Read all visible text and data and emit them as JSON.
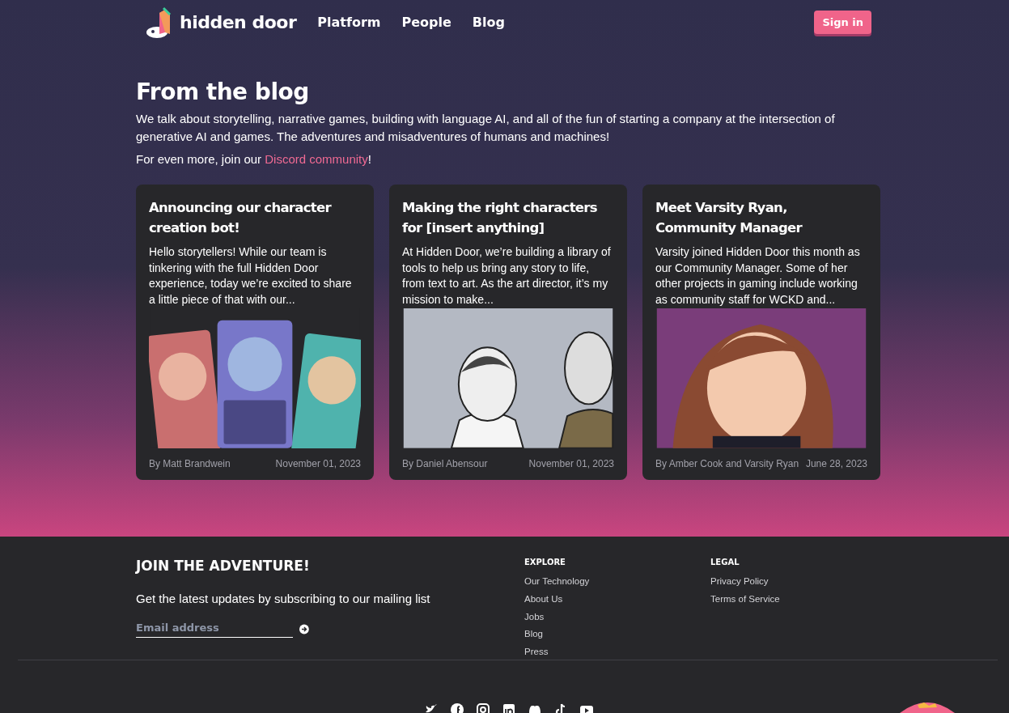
{
  "header": {
    "logo_text": "hidden door",
    "nav": [
      {
        "label": "Platform"
      },
      {
        "label": "People"
      },
      {
        "label": "Blog"
      }
    ],
    "sign_in": "Sign in"
  },
  "intro": {
    "title": "From the blog",
    "description": "We talk about storytelling, narrative games, building with language AI, and all of the fun of starting a company at the intersection of generative AI and games. The adventures and misadventures of humans and machines!",
    "more_prefix": "For even more, join our ",
    "more_link": "Discord community",
    "more_suffix": "!"
  },
  "posts": [
    {
      "title": "Announcing our character creation bot!",
      "excerpt": "Hello storytellers! While our team is tinkering with the full Hidden Door experience, today we’re excited to share a little piece of that with our...",
      "kind": "character-cards",
      "author": "By Matt Brandwein",
      "date": "November 01, 2023"
    },
    {
      "title": "Making the right characters for [insert anything]",
      "excerpt": "At Hidden Door, we’re building a library of tools to help us bring any story to life, from text to art. As the art director, it’s my mission to make...",
      "kind": "two-figures",
      "author": "By Daniel Abensour",
      "date": "November 01, 2023"
    },
    {
      "title": "Meet Varsity Ryan, Community Manager",
      "excerpt": "Varsity joined Hidden Door this month as our Community Manager. Some of her other projects in gaming include working as community staff for WCKD and...",
      "kind": "portrait",
      "author": "By Amber Cook and Varsity Ryan",
      "date": "June 28, 2023"
    }
  ],
  "footer": {
    "heading": "JOIN THE ADVENTURE!",
    "subtitle": "Get the latest updates by subscribing to our mailing list",
    "email_placeholder": "Email address",
    "columns": [
      {
        "title": "EXPLORE",
        "links": [
          "Our Technology",
          "About Us",
          "Jobs",
          "Blog",
          "Press"
        ]
      },
      {
        "title": "LEGAL",
        "links": [
          "Privacy Policy",
          "Terms of Service"
        ]
      }
    ]
  }
}
